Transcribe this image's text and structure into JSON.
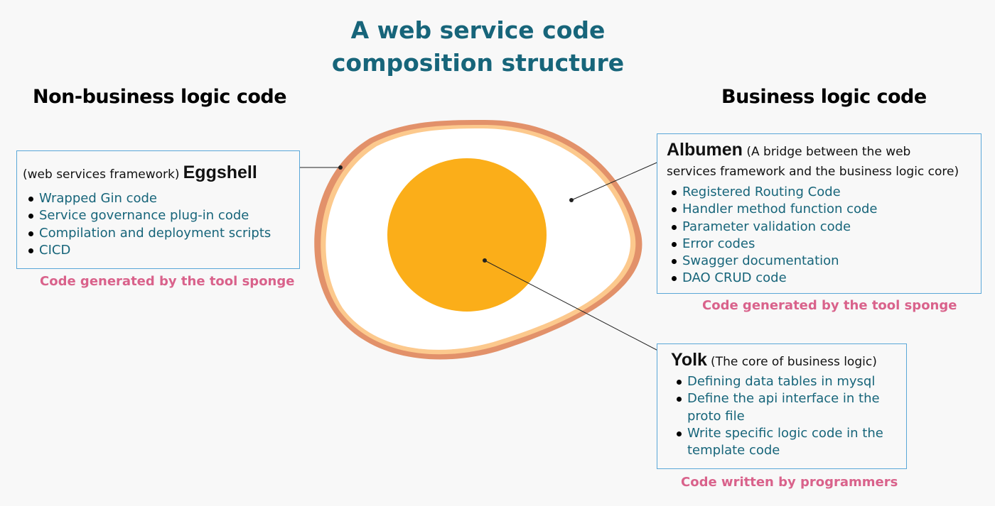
{
  "title": {
    "line1": "A web service code",
    "line2": "composition structure"
  },
  "columns": {
    "left_heading": "Non-business logic code",
    "right_heading": "Business logic code"
  },
  "colors": {
    "title": "#17657a",
    "list_text": "#17657a",
    "note_text": "#d9628b",
    "box_border": "#5aa7d8",
    "shell_outer": "#e2916a",
    "shell_inner": "#fcc98d",
    "albumen": "#ffffff",
    "yolk": "#fbae19"
  },
  "eggshell": {
    "prefix": "(web services framework)",
    "name": "Eggshell",
    "items": [
      "Wrapped Gin code",
      "Service governance plug-in code",
      "Compilation and deployment scripts",
      "CICD"
    ],
    "note": "Code generated by the tool sponge"
  },
  "albumen": {
    "name": "Albumen",
    "desc_line1": "(A bridge between the web",
    "desc_line2": "services framework and the business logic core)",
    "items": [
      "Registered Routing Code",
      "Handler method function code",
      "Parameter validation code",
      "Error codes",
      "Swagger documentation",
      "DAO CRUD code"
    ],
    "note": "Code generated by the tool sponge"
  },
  "yolk": {
    "name": "Yolk",
    "desc": "(The core of business logic)",
    "items": [
      "Defining data tables in mysql",
      "Define the api interface in the proto file",
      "Write specific logic code in the template code"
    ],
    "note": "Code written by programmers"
  }
}
